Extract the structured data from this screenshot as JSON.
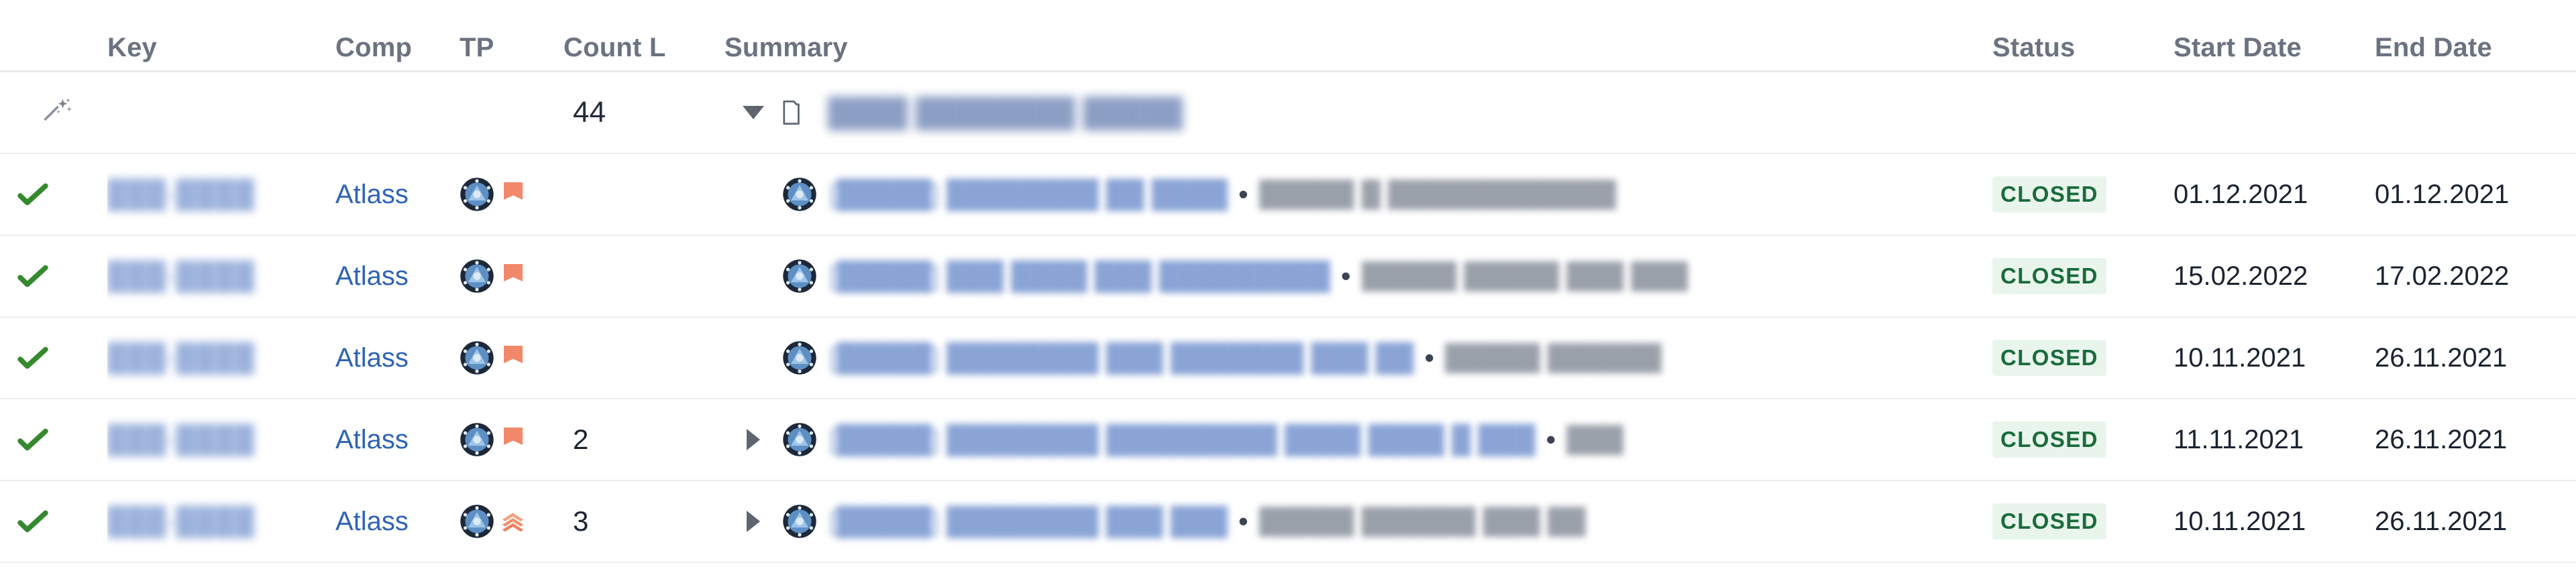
{
  "table": {
    "columns": [
      {
        "id": "status-icon",
        "label": "",
        "icon": "resolution-check-icon"
      },
      {
        "id": "key",
        "label": "Key"
      },
      {
        "id": "company",
        "label": "Comp"
      },
      {
        "id": "tp",
        "label": "TP"
      },
      {
        "id": "count_links",
        "label": "Count L"
      },
      {
        "id": "summary",
        "label": "Summary"
      },
      {
        "id": "status",
        "label": "Status"
      },
      {
        "id": "start_date",
        "label": "Start Date"
      },
      {
        "id": "end_date",
        "label": "End Date"
      }
    ],
    "group_row": {
      "wand_icon": "magic-wand-icon",
      "count": "44",
      "toggle_icon": "chevron-down-icon",
      "folder_icon": "folder-icon",
      "title": "████ ████████ █████"
    },
    "rows": [
      {
        "resolution_icon": "green-check-icon",
        "key": "███-████",
        "company": "Atlass",
        "tp_avatar": "arc-reactor-avatar-icon",
        "tp_priority": "priority-medium-flag-icon",
        "count_links": "",
        "expand_icon": "",
        "summary_avatar": "arc-reactor-avatar-icon",
        "summary_link": "[█████] ████████ ██ ████",
        "summary_separator": "•",
        "summary_desc": "█████ █ ████████████",
        "status": "CLOSED",
        "start_date": "01.12.2021",
        "end_date": "01.12.2021"
      },
      {
        "resolution_icon": "green-check-icon",
        "key": "███-████",
        "company": "Atlass",
        "tp_avatar": "arc-reactor-avatar-icon",
        "tp_priority": "priority-medium-flag-icon",
        "count_links": "",
        "expand_icon": "",
        "summary_avatar": "arc-reactor-avatar-icon",
        "summary_link": "[█████] ███ ████ ███ █████████",
        "summary_separator": "•",
        "summary_desc": "█████ █████ ███ ███",
        "status": "CLOSED",
        "start_date": "15.02.2022",
        "end_date": "17.02.2022"
      },
      {
        "resolution_icon": "green-check-icon",
        "key": "███-████",
        "company": "Atlass",
        "tp_avatar": "arc-reactor-avatar-icon",
        "tp_priority": "priority-medium-flag-icon",
        "count_links": "",
        "expand_icon": "",
        "summary_avatar": "arc-reactor-avatar-icon",
        "summary_link": "[█████] ████████ ███ ███████ ███ ██",
        "summary_separator": "•",
        "summary_desc": "█████ ██████",
        "status": "CLOSED",
        "start_date": "10.11.2021",
        "end_date": "26.11.2021"
      },
      {
        "resolution_icon": "green-check-icon",
        "key": "███-████",
        "company": "Atlass",
        "tp_avatar": "arc-reactor-avatar-icon",
        "tp_priority": "priority-medium-flag-icon",
        "count_links": "2",
        "expand_icon": "chevron-right-icon",
        "summary_avatar": "arc-reactor-avatar-icon",
        "summary_link": "[█████] ████████ █████████ ████ ████ █ ███",
        "summary_separator": "•",
        "summary_desc": "███",
        "status": "CLOSED",
        "start_date": "11.11.2021",
        "end_date": "26.11.2021"
      },
      {
        "resolution_icon": "green-check-icon",
        "key": "███-████",
        "company": "Atlass",
        "tp_avatar": "arc-reactor-avatar-icon",
        "tp_priority": "priority-highest-chevrons-icon",
        "count_links": "3",
        "expand_icon": "chevron-right-icon",
        "summary_avatar": "arc-reactor-avatar-icon",
        "summary_link": "[█████] ████████ ███ ███",
        "summary_separator": "•",
        "summary_desc": "█████ ██████ ███ ██",
        "status": "CLOSED",
        "start_date": "10.11.2021",
        "end_date": "26.11.2021"
      }
    ]
  },
  "colors": {
    "status_badge_text": "#1a6b3c",
    "status_badge_bg": "#e9f5ec",
    "link": "#2f63b5",
    "key_link": "#8aa4d6",
    "header_text": "#6b7280",
    "check_green": "#36892f",
    "priority_orange": "#f08060",
    "row_border": "#eceef1"
  }
}
